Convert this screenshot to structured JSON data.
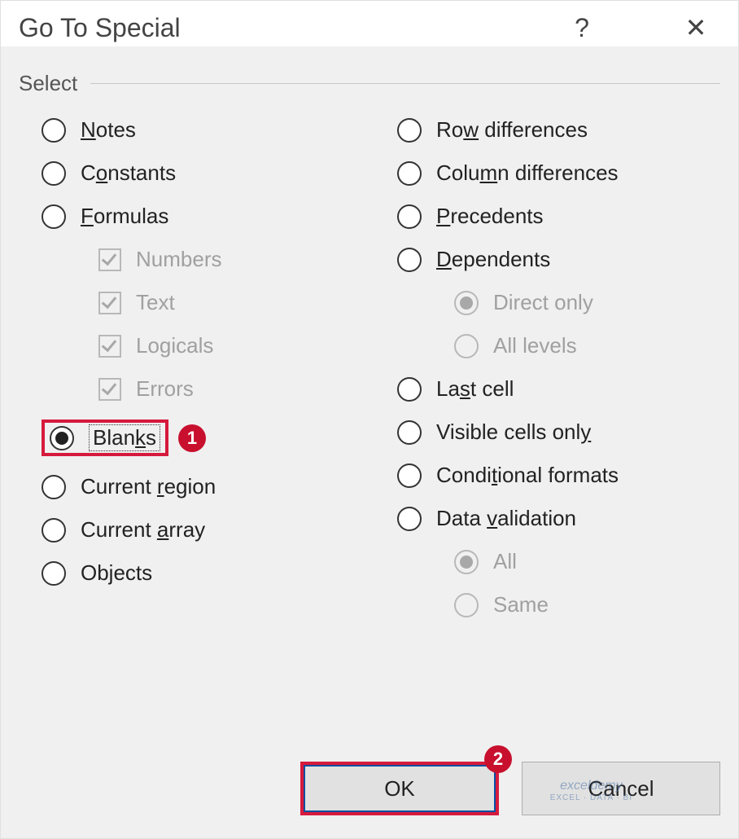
{
  "dialog": {
    "title": "Go To Special",
    "help_glyph": "?",
    "close_glyph": "✕",
    "group_label": "Select",
    "ok_label": "OK",
    "cancel_label": "Cancel"
  },
  "left_col": {
    "notes": {
      "pre": "",
      "u": "N",
      "post": "otes"
    },
    "constants": {
      "pre": "C",
      "u": "o",
      "post": "nstants"
    },
    "formulas": {
      "pre": "",
      "u": "F",
      "post": "ormulas"
    },
    "numbers": {
      "label": "Numbers"
    },
    "text": {
      "label": "Text"
    },
    "logicals": {
      "label": "Logicals"
    },
    "errors": {
      "label": "Errors"
    },
    "blanks": {
      "pre": "Blan",
      "u": "k",
      "post": "s"
    },
    "cur_region": {
      "pre": "Current ",
      "u": "r",
      "post": "egion"
    },
    "cur_array": {
      "pre": "Current ",
      "u": "a",
      "post": "rray"
    },
    "objects": {
      "label": "Objects"
    }
  },
  "right_col": {
    "row_diff": {
      "pre": "Ro",
      "u": "w",
      "post": " differences"
    },
    "col_diff": {
      "pre": "Colu",
      "u": "m",
      "post": "n differences"
    },
    "precedents": {
      "pre": "",
      "u": "P",
      "post": "recedents"
    },
    "dependents": {
      "pre": "",
      "u": "D",
      "post": "ependents"
    },
    "direct_only": {
      "label": "Direct only"
    },
    "all_levels": {
      "label": "All levels"
    },
    "last_cell": {
      "pre": "La",
      "u": "s",
      "post": "t cell"
    },
    "visible": {
      "pre": "Visible cells onl",
      "u": "y",
      "post": ""
    },
    "cond_fmt": {
      "pre": "Condi",
      "u": "t",
      "post": "ional formats"
    },
    "data_val": {
      "pre": "Data ",
      "u": "v",
      "post": "alidation"
    },
    "dv_all": {
      "label": "All"
    },
    "dv_same": {
      "label": "Same"
    }
  },
  "badges": {
    "one": "1",
    "two": "2"
  },
  "watermark": {
    "line1": "exceldemy",
    "line2": "EXCEL · DATA · BI"
  }
}
